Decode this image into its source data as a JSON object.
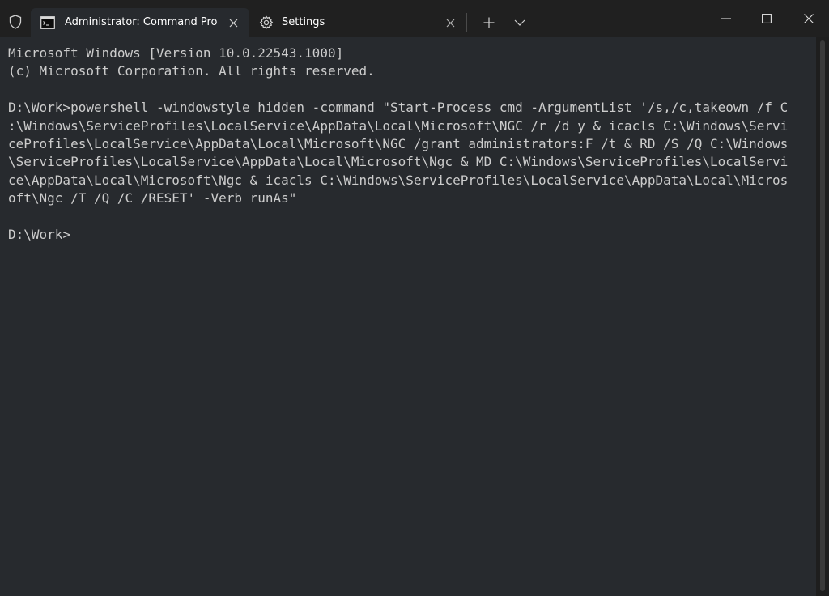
{
  "tabs": [
    {
      "title": "Administrator: Command Prompt",
      "icon": "cmd-icon",
      "active": true
    },
    {
      "title": "Settings",
      "icon": "gear-icon",
      "active": false
    }
  ],
  "terminal": {
    "lines": [
      "Microsoft Windows [Version 10.0.22543.1000]",
      "(c) Microsoft Corporation. All rights reserved.",
      "",
      "D:\\Work>powershell -windowstyle hidden -command \"Start-Process cmd -ArgumentList '/s,/c,takeown /f C",
      ":\\Windows\\ServiceProfiles\\LocalService\\AppData\\Local\\Microsoft\\NGC /r /d y & icacls C:\\Windows\\Servi",
      "ceProfiles\\LocalService\\AppData\\Local\\Microsoft\\NGC /grant administrators:F /t & RD /S /Q C:\\Windows",
      "\\ServiceProfiles\\LocalService\\AppData\\Local\\Microsoft\\Ngc & MD C:\\Windows\\ServiceProfiles\\LocalServi",
      "ce\\AppData\\Local\\Microsoft\\Ngc & icacls C:\\Windows\\ServiceProfiles\\LocalService\\AppData\\Local\\Micros",
      "oft\\Ngc /T /Q /C /RESET' -Verb runAs\"",
      "",
      "D:\\Work>"
    ]
  },
  "colors": {
    "titlebar": "#202020",
    "terminal_bg": "#272a2e",
    "terminal_fg": "#cccccc"
  }
}
